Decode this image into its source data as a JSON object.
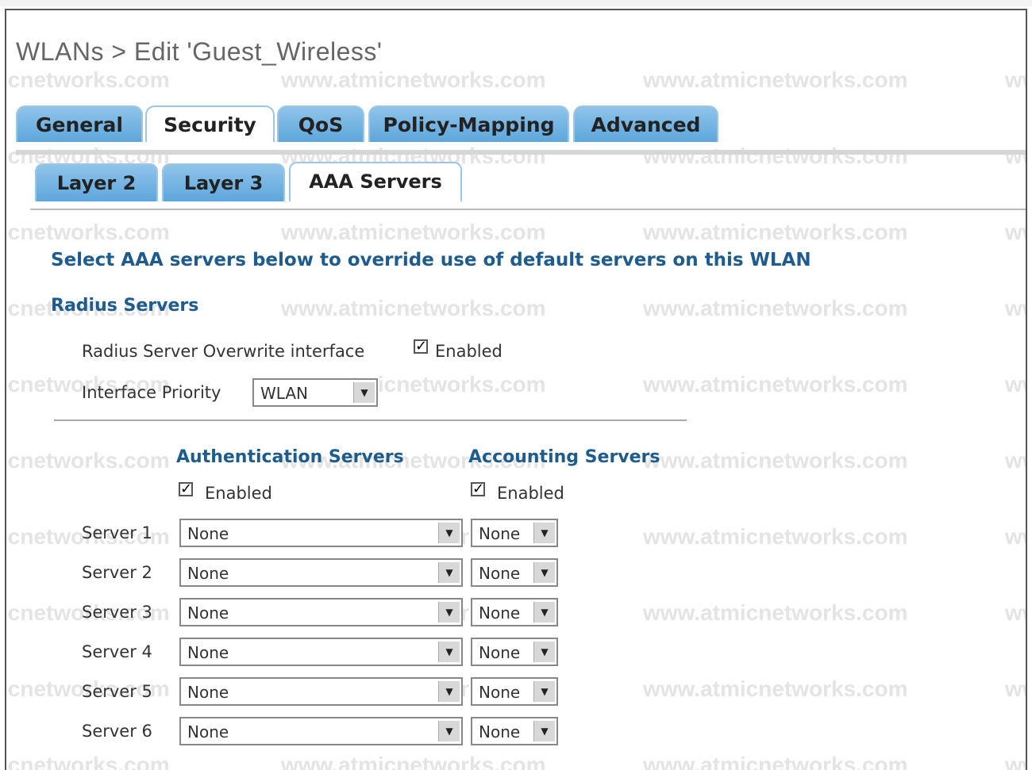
{
  "page": {
    "title": "WLANs > Edit  'Guest_Wireless'"
  },
  "tabs": [
    "General",
    "Security",
    "QoS",
    "Policy-Mapping",
    "Advanced"
  ],
  "subtabs": [
    "Layer 2",
    "Layer 3",
    "AAA Servers"
  ],
  "instruction": "Select AAA servers below to override use of default servers on this WLAN",
  "radius": {
    "heading": "Radius Servers",
    "overwrite_label": "Radius Server Overwrite interface",
    "overwrite_checkbox_label": "Enabled",
    "overwrite_checked": true,
    "priority_label": "Interface Priority",
    "priority_value": "WLAN"
  },
  "auth": {
    "heading": "Authentication Servers",
    "enabled_label": "Enabled",
    "enabled": true
  },
  "acct": {
    "heading": "Accounting Servers",
    "enabled_label": "Enabled",
    "enabled": true
  },
  "servers": [
    {
      "label": "Server 1",
      "auth": "None",
      "acct": "None"
    },
    {
      "label": "Server 2",
      "auth": "None",
      "acct": "None"
    },
    {
      "label": "Server 3",
      "auth": "None",
      "acct": "None"
    },
    {
      "label": "Server 4",
      "auth": "None",
      "acct": "None"
    },
    {
      "label": "Server 5",
      "auth": "None",
      "acct": "None"
    },
    {
      "label": "Server 6",
      "auth": "None",
      "acct": "None"
    }
  ],
  "watermark": {
    "text": "www.atmicnetworks.com",
    "partial_left": "icnetworks.com",
    "partial_right": "ww"
  },
  "icons": {
    "dropdown": "chevron-down-icon",
    "check": "checkmark-icon"
  },
  "colors": {
    "tab_blue": "#5ea6dc",
    "heading_blue": "#1f5c8e"
  }
}
